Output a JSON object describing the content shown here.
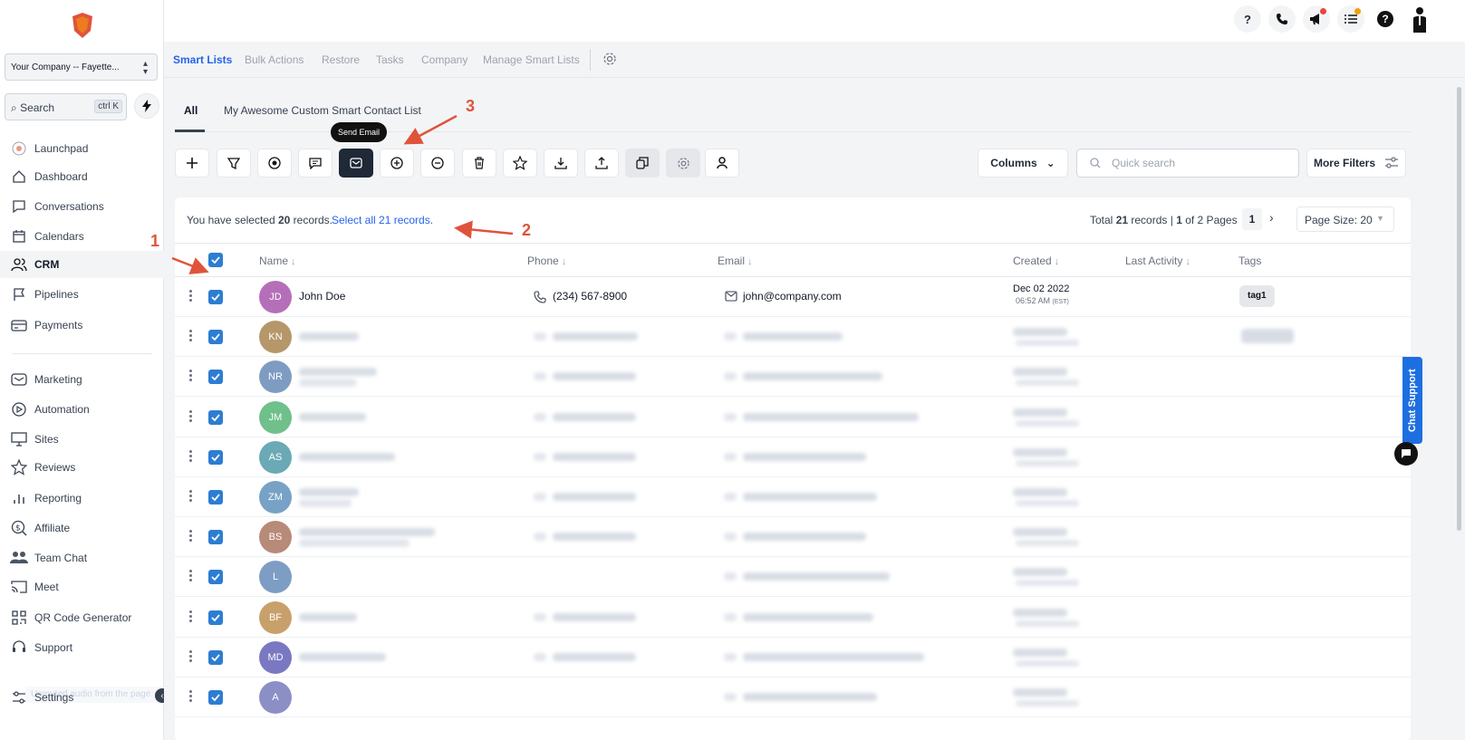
{
  "company": {
    "name": "Your Company -- Fayette..."
  },
  "search": {
    "placeholder": "Search",
    "shortcut": "ctrl K"
  },
  "sidebar": {
    "items": [
      {
        "label": "Launchpad",
        "icon": "rocket-icon"
      },
      {
        "label": "Dashboard",
        "icon": "home-icon"
      },
      {
        "label": "Conversations",
        "icon": "chat-icon"
      },
      {
        "label": "Calendars",
        "icon": "calendar-icon"
      },
      {
        "label": "CRM",
        "icon": "users-icon",
        "active": true
      },
      {
        "label": "Pipelines",
        "icon": "flag-icon"
      },
      {
        "label": "Payments",
        "icon": "card-icon"
      },
      {
        "label": "Marketing",
        "icon": "mail-icon"
      },
      {
        "label": "Automation",
        "icon": "play-icon"
      },
      {
        "label": "Sites",
        "icon": "monitor-icon"
      },
      {
        "label": "Reviews",
        "icon": "star-icon"
      },
      {
        "label": "Reporting",
        "icon": "bars-icon"
      },
      {
        "label": "Affiliate",
        "icon": "dollar-icon"
      },
      {
        "label": "Team Chat",
        "icon": "team-icon"
      },
      {
        "label": "Meet",
        "icon": "cast-icon"
      },
      {
        "label": "QR Code Generator",
        "icon": "qr-icon"
      },
      {
        "label": "Support",
        "icon": "headset-icon"
      }
    ],
    "settings": "Settings",
    "audio_hint": "Unmuted audio from the page"
  },
  "subnav": {
    "tabs": [
      "Smart Lists",
      "Bulk Actions",
      "Restore",
      "Tasks",
      "Company",
      "Manage Smart Lists"
    ]
  },
  "lists": {
    "tabs": [
      "All",
      "My Awesome Custom Smart Contact List"
    ]
  },
  "toolbar": {
    "tooltip": "Send Email",
    "columns_label": "Columns",
    "quick_search_placeholder": "Quick search",
    "more_filters_label": "More Filters"
  },
  "selection": {
    "prefix": "You have selected ",
    "count": "20",
    "suffix": " records.",
    "select_all": "Select all 21 records.",
    "total_prefix": "Total ",
    "total_count": "21",
    "total_mid": " records | ",
    "page": "1",
    "page_of": " of 2 Pages",
    "page_size": "Page Size: 20"
  },
  "table": {
    "headers": [
      "Name",
      "Phone",
      "Email",
      "Created",
      "Last Activity",
      "Tags"
    ],
    "rows": [
      {
        "initials": "JD",
        "color": "#b56fb8",
        "name": "John Doe",
        "phone": "(234) 567-8900",
        "email": "john@company.com",
        "created_date": "Dec 02 2022",
        "created_time": "06:52 AM",
        "tz": "(EST)",
        "tag": "tag1"
      },
      {
        "initials": "KN",
        "color": "#b5976a"
      },
      {
        "initials": "NR",
        "color": "#7e9cc2"
      },
      {
        "initials": "JM",
        "color": "#6fc08a"
      },
      {
        "initials": "AS",
        "color": "#6aa9b5"
      },
      {
        "initials": "ZM",
        "color": "#77a2c6"
      },
      {
        "initials": "BS",
        "color": "#b88a78"
      },
      {
        "initials": "L",
        "color": "#7d9dc4"
      },
      {
        "initials": "BF",
        "color": "#c8a06c"
      },
      {
        "initials": "MD",
        "color": "#7a78c2"
      },
      {
        "initials": "A",
        "color": "#8c8fc6"
      }
    ]
  },
  "annotations": [
    "1",
    "2",
    "3"
  ],
  "chat_support": "Chat Support"
}
